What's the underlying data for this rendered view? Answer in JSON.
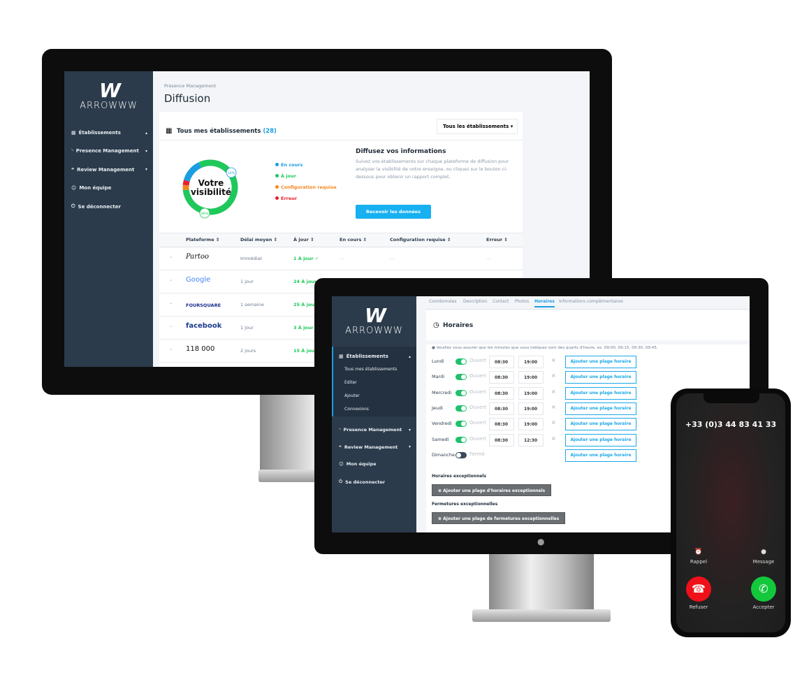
{
  "brand": {
    "logo_mark": "W",
    "logo_text": "ARROWWW"
  },
  "desktop": {
    "sidebar": [
      {
        "label": "Établissements",
        "icon": "building-icon",
        "caret": "▴"
      },
      {
        "label": "Presence Management",
        "icon": "rss-icon",
        "caret": "▾"
      },
      {
        "label": "Review Management",
        "icon": "comments-icon",
        "caret": "▾"
      },
      {
        "label": "Mon équipe",
        "icon": "users-icon",
        "caret": ""
      },
      {
        "label": "Se déconnecter",
        "icon": "power-icon",
        "caret": ""
      }
    ],
    "breadcrumb": "Presence Management",
    "title": "Diffusion",
    "card_title": "Tous mes établissements",
    "card_count": "(28)",
    "filter": "Tous les établissements",
    "donut": {
      "center_line1": "Votre",
      "center_line2": "visibilité",
      "label_en_cours": "14%",
      "label_a_jour": "80%",
      "segments": [
        {
          "name": "À jour",
          "value": 80,
          "color": "#1fc85a"
        },
        {
          "name": "Configuration requise",
          "value": 3,
          "color": "#f5861f"
        },
        {
          "name": "Erreur",
          "value": 3,
          "color": "#e8212e"
        },
        {
          "name": "En cours",
          "value": 14,
          "color": "#1a9ee0"
        }
      ]
    },
    "legend": [
      {
        "label": "En cours",
        "color": "#1a9ee0"
      },
      {
        "label": "À jour",
        "color": "#1fc85a"
      },
      {
        "label": "Configuration requise",
        "color": "#f5861f"
      },
      {
        "label": "Erreur",
        "color": "#e8212e"
      }
    ],
    "info_title": "Diffusez vos informations",
    "info_text": "Suivez vos établissements sur chaque plateforme de diffusion pour analyser la visibilité de votre enseigne, ou cliquez sur le bouton ci-dessous pour obtenir un rapport complet.",
    "cta": "Recevoir les données",
    "columns": [
      "Plateforme ⇕",
      "Délai moyen ⇕",
      "À jour ⇕",
      "En cours ⇕",
      "Configuration requise ⇕",
      "Erreur ⇕"
    ],
    "rows": [
      {
        "platform": "Partoo",
        "delay": "Immédiat",
        "ajour": "1 À jour ✓",
        "encours": "—",
        "config": "—",
        "erreur": "—"
      },
      {
        "platform": "Google",
        "delay": "1 jour",
        "ajour": "24 À jour",
        "encours": "",
        "config": "",
        "erreur": ""
      },
      {
        "platform": "FOURSQUARE",
        "delay": "1 semaine",
        "ajour": "25 À jour",
        "encours": "",
        "config": "",
        "erreur": ""
      },
      {
        "platform": "facebook",
        "delay": "1 jour",
        "ajour": "3 À jour",
        "encours": "",
        "config": "",
        "erreur": ""
      },
      {
        "platform": "118 000",
        "delay": "2 jours",
        "ajour": "15 À jour",
        "encours": "",
        "config": "",
        "erreur": ""
      }
    ]
  },
  "laptop": {
    "sidebar_main": "Établissements",
    "sub": [
      "Tous mes établissements",
      "Editer",
      "Ajouter",
      "Connexions"
    ],
    "sidebar": [
      {
        "label": "Presence Management",
        "caret": "▾"
      },
      {
        "label": "Review Management",
        "caret": "▾"
      },
      {
        "label": "Mon équipe",
        "caret": ""
      },
      {
        "label": "Se déconnecter",
        "caret": ""
      }
    ],
    "tabs": [
      "Coordonnées",
      "Description",
      "Contact",
      "Photos",
      "Horaires",
      "Informations complémentaires"
    ],
    "active_tab": "Horaires",
    "section_title": "Horaires",
    "notice": "Veuillez vous assurer que les minutes que vous indiquez sont des quarts d'heure, ex. 09:00, 09:15, 09:30, 09:45.",
    "days": [
      {
        "day": "Lundi",
        "open": true,
        "status": "Ouvert",
        "from": "08:30",
        "to": "19:00"
      },
      {
        "day": "Mardi",
        "open": true,
        "status": "Ouvert",
        "from": "08:30",
        "to": "19:00"
      },
      {
        "day": "Mercredi",
        "open": true,
        "status": "Ouvert",
        "from": "08:30",
        "to": "19:00"
      },
      {
        "day": "Jeudi",
        "open": true,
        "status": "Ouvert",
        "from": "08:30",
        "to": "19:00"
      },
      {
        "day": "Vendredi",
        "open": true,
        "status": "Ouvert",
        "from": "08:30",
        "to": "19:00"
      },
      {
        "day": "Samedi",
        "open": true,
        "status": "Ouvert",
        "from": "08:30",
        "to": "12:30"
      },
      {
        "day": "Dimanche",
        "open": false,
        "status": "Fermé",
        "from": "",
        "to": ""
      }
    ],
    "add_slot": "Ajouter une plage horaire",
    "remove": "×",
    "exc_hours_title": "Horaires exceptionnels",
    "exc_hours_btn": "Ajouter une plage d'horaires exceptionnels",
    "exc_close_title": "Fermetures exceptionnelles",
    "exc_close_btn": "Ajouter une plage de fermetures exceptionnelles"
  },
  "phone": {
    "number": "+33 (0)3 44 83 41 33",
    "remind": "Rappel",
    "message": "Message",
    "decline": "Refuser",
    "accept": "Accepter",
    "decline_color": "#f0101a",
    "accept_color": "#14c83c"
  }
}
